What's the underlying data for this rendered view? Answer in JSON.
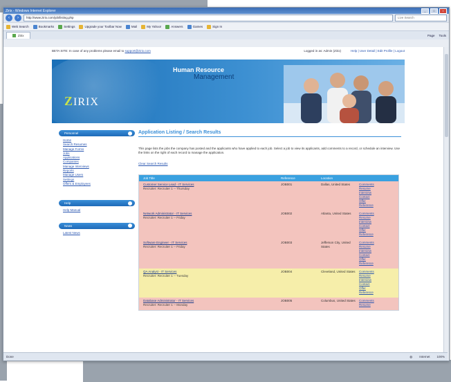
{
  "browser": {
    "title": "Zirix - Windows Internet Explorer",
    "url": "http://www.zirix.com/job/listing.php",
    "search_placeholder": "Live Search",
    "toolbar_items": [
      "Web Search",
      "Bookmarks",
      "Settings",
      "Upgrade your Toolbar Now",
      "Mail",
      "My Yahoo!",
      "Answers",
      "Games",
      "Sign In"
    ],
    "tab_label": "Zirix",
    "tab_tools": [
      "Page",
      "Tools"
    ],
    "status_left": "Done",
    "status_zone": "Internet",
    "status_zoom": "100%"
  },
  "page": {
    "note": "BETA SITE: In case of any problems please email to",
    "note_link": "support@zirix.com",
    "logged_in": "Logged in as: Admin (Zirix)",
    "header_links": "Help | User Detail | Edit Profile | Logout"
  },
  "banner": {
    "title_line1": "Human Resource",
    "title_line2": "Management",
    "logo_z": "Z",
    "logo_rest": "IRIX"
  },
  "sidebar": {
    "section1_title": "Personnel",
    "section1_links": [
      "Home",
      "Search Resumes",
      "Manage Forms",
      "Jobs",
      "Applications",
      "Companies",
      "Manage Interviews",
      "Reports",
      "Manage Users",
      "Settings",
      "Offers & Employees"
    ],
    "section2_title": "Help",
    "section2_links": [
      "Help Manual"
    ],
    "section3_title": "News",
    "section3_links": [
      "Latest News"
    ]
  },
  "main": {
    "heading": "Application Listing / Search Results",
    "intro": "This page lists the jobs the company has posted and the applicants who have applied to each job. Select a job to view its applicants, add comments to a record, or schedule an interview. Use the links on the right of each record to manage the application.",
    "clear_link": "Clear Search Results",
    "columns": [
      "Job Title",
      "Reference",
      "Location",
      ""
    ],
    "rows": [
      {
        "color": "pink",
        "title": "Customer Service Lead - IT Services",
        "sub": "Recruiter: Recruiter 1 -- Thursday",
        "ref": "JOB001",
        "location": "Dallas, United States",
        "actions": [
          "Comments",
          "Resume",
          "Interview",
          "Contact",
          "Offer",
          "Reference"
        ]
      },
      {
        "color": "pink",
        "title": "Network Administrator - IT Services",
        "sub": "Recruiter: Recruiter 1 -- Friday",
        "ref": "JOB002",
        "location": "Atlanta, United States",
        "actions": [
          "Comments",
          "Resume",
          "Interview",
          "Contact",
          "Offer",
          "Reference"
        ]
      },
      {
        "color": "pink",
        "title": "Software Engineer - IT Services",
        "sub": "Recruiter: Recruiter 1 -- Friday",
        "ref": "JOB003",
        "location": "Jefferson City, United States",
        "actions": [
          "Comments",
          "Resume",
          "Interview",
          "Contact",
          "Offer",
          "Reference"
        ]
      },
      {
        "color": "yellow",
        "title": "QA Analyst - IT Services",
        "sub": "Recruiter: Recruiter 1 -- Tuesday",
        "ref": "JOB004",
        "location": "Cleveland, United States",
        "actions": [
          "Comments",
          "Resume",
          "Interview",
          "Contact",
          "Offer",
          "Reference"
        ]
      },
      {
        "color": "pink",
        "title": "Database Administrator - IT Services",
        "sub": "Recruiter: Recruiter 1 -- Monday",
        "ref": "JOB005",
        "location": "Columbus, United States",
        "actions": [
          "Comments",
          "Resume"
        ]
      }
    ]
  }
}
